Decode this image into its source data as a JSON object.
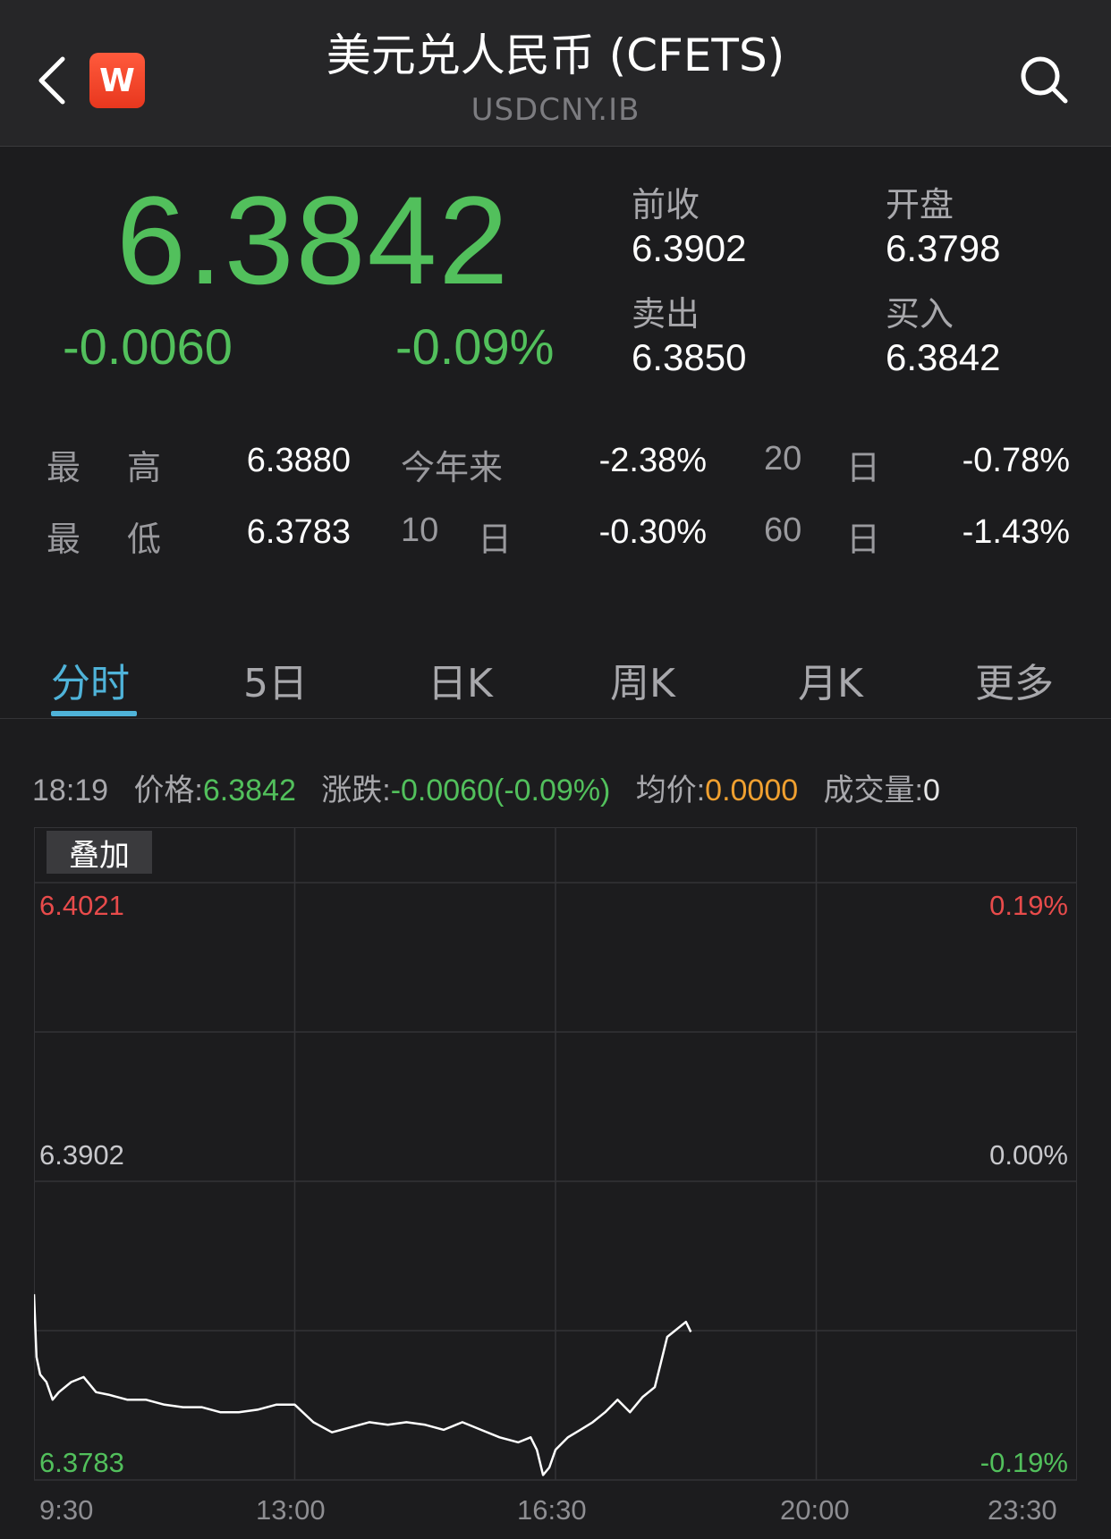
{
  "header": {
    "title": "美元兑人民币 (CFETS)",
    "symbol": "USDCNY.IB",
    "logo_text": "W",
    "back_icon": "chevron-left-icon",
    "search_icon": "search-icon"
  },
  "quote": {
    "price": "6.3842",
    "change": "-0.0060",
    "change_pct": "-0.09%",
    "prev_close_label": "前收",
    "prev_close": "6.3902",
    "open_label": "开盘",
    "open": "6.3798",
    "ask_label": "卖出",
    "ask": "6.3850",
    "bid_label": "买入",
    "bid": "6.3842"
  },
  "stats": {
    "high_label_a": "最",
    "high_label_b": "高",
    "high": "6.3880",
    "low_label_a": "最",
    "low_label_b": "低",
    "low": "6.3783",
    "ytd_label": "今年来",
    "ytd": "-2.38%",
    "d10_num": "10",
    "d10_unit": "日",
    "d10": "-0.30%",
    "d20_num": "20",
    "d20_unit": "日",
    "d20": "-0.78%",
    "d60_num": "60",
    "d60_unit": "日",
    "d60": "-1.43%"
  },
  "tabs": [
    "分时",
    "5日",
    "日K",
    "周K",
    "月K",
    "更多"
  ],
  "info": {
    "time": "18:19",
    "price_label": "价格:",
    "price": "6.3842",
    "change_label": "涨跌:",
    "change": "-0.0060(-0.09%)",
    "avg_label": "均价:",
    "avg": "0.0000",
    "vol_label": "成交量:",
    "vol": "0"
  },
  "overlay_button": "叠加",
  "colors": {
    "up": "#e84b4b",
    "down": "#52c05c",
    "accent": "#4fb3d9",
    "avg": "#f0a030"
  },
  "chart_data": {
    "type": "line",
    "title": "",
    "y_left_labels": {
      "top": "6.4021",
      "mid": "6.3902",
      "bottom": "6.3783"
    },
    "y_right_labels": {
      "top": "0.19%",
      "mid": "0.00%",
      "bottom": "-0.19%"
    },
    "ylim": [
      6.3783,
      6.4021
    ],
    "x_tick_labels": [
      "9:30",
      "13:00",
      "16:30",
      "20:00",
      "23:30"
    ],
    "xlim": [
      "9:30",
      "23:30"
    ],
    "grid": true,
    "series": [
      {
        "x": [
          "9:30",
          "9:32",
          "9:35",
          "9:40",
          "9:45",
          "9:50",
          "10:00",
          "10:10",
          "10:20",
          "10:30",
          "10:45",
          "11:00",
          "11:15",
          "11:30",
          "11:45",
          "12:00",
          "12:15",
          "12:30",
          "12:45",
          "13:00",
          "13:15",
          "13:30",
          "13:45",
          "14:00",
          "14:15",
          "14:30",
          "14:45",
          "15:00",
          "15:15",
          "15:30",
          "15:45",
          "16:00",
          "16:10",
          "16:15",
          "16:20",
          "16:25",
          "16:30",
          "16:40",
          "16:50",
          "17:00",
          "17:10",
          "17:20",
          "17:30",
          "17:40",
          "17:50",
          "17:55",
          "18:00",
          "18:05",
          "18:10",
          "18:15",
          "18:19"
        ],
        "y": [
          6.3857,
          6.3832,
          6.3825,
          6.3822,
          6.3815,
          6.3818,
          6.3822,
          6.3824,
          6.3818,
          6.3817,
          6.3815,
          6.3815,
          6.3813,
          6.3812,
          6.3812,
          6.381,
          6.381,
          6.3811,
          6.3813,
          6.3813,
          6.3806,
          6.3802,
          6.3804,
          6.3806,
          6.3805,
          6.3806,
          6.3805,
          6.3803,
          6.3806,
          6.3803,
          6.38,
          6.3798,
          6.38,
          6.3795,
          6.3785,
          6.3788,
          6.3795,
          6.38,
          6.3803,
          6.3806,
          6.381,
          6.3815,
          6.381,
          6.3816,
          6.382,
          6.383,
          6.384,
          6.3842,
          6.3844,
          6.3846,
          6.3842
        ]
      }
    ]
  }
}
